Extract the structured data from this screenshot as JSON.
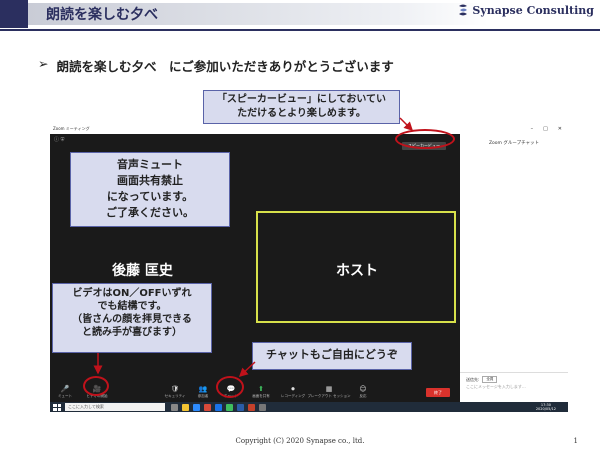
{
  "header": {
    "title": "朗読を楽しむ夕べ",
    "logo_text": "Synapse Consulting"
  },
  "subtitle": {
    "bullet": "➢",
    "text": "朗読を楽しむ夕べ　にご参加いただきありがとうございます"
  },
  "zoom": {
    "window_title": "Zoom ミーティング",
    "speaker_view_label": "スピーカービュー",
    "participant_left": "後藤 匡史",
    "participant_right": "ホスト",
    "chat_title": "Zoom グループチャット",
    "chat_to_label": "送信先:",
    "chat_to_value": "全員",
    "chat_placeholder": "ここにメッセージを入力します...",
    "end_label": "終了",
    "toolbar": [
      {
        "icon": "mic-icon",
        "glyph": "🎤",
        "label": "ミュート"
      },
      {
        "icon": "video-icon",
        "glyph": "🎥",
        "label": "ビデオの開始"
      },
      {
        "icon": "security-icon",
        "glyph": "🛡",
        "label": "セキュリティ"
      },
      {
        "icon": "participants-icon",
        "glyph": "👥",
        "label": "参加者"
      },
      {
        "icon": "chat-icon",
        "glyph": "💬",
        "label": "チャット"
      },
      {
        "icon": "share-screen-icon",
        "glyph": "⬆",
        "label": "画面を共有"
      },
      {
        "icon": "record-icon",
        "glyph": "⏺",
        "label": "レコーディング"
      },
      {
        "icon": "breakout-icon",
        "glyph": "▦",
        "label": "ブレークアウト セッション"
      },
      {
        "icon": "reaction-icon",
        "glyph": "☺",
        "label": "反応"
      }
    ],
    "taskbar_search": "ここに入力して検索",
    "taskbar_time": "17:30",
    "taskbar_date": "2020/05/12"
  },
  "callouts": {
    "speaker": [
      "「スピーカービュー」にしておいてい",
      "ただけるとより楽しめます。"
    ],
    "mute": [
      "音声ミュート",
      "画面共有禁止",
      "になっています。",
      "ご了承ください。"
    ],
    "video": [
      "ビデオはON／OFFいずれ",
      "でも結構です。",
      "（皆さんの顔を拝見できる",
      "と読み手が喜びます）"
    ],
    "chat": "チャットもご自由にどうぞ"
  },
  "footer": {
    "copyright": "Copyright (C) 2020 Synapse co., ltd.",
    "page": "1"
  },
  "colors": {
    "navy": "#2b2f5f",
    "callout_bg": "#d8dbee",
    "ring_red": "#c0121b",
    "host_border": "#d7e04a",
    "end_red": "#d9322c"
  }
}
